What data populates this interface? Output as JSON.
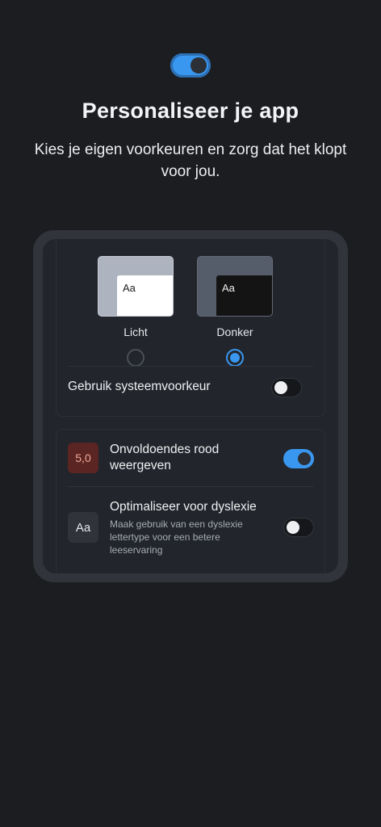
{
  "header": {
    "title": "Personaliseer je app",
    "subtitle": "Kies je eigen voorkeuren en zorg dat het klopt voor jou."
  },
  "theme": {
    "light": {
      "sample": "Aa",
      "label": "Licht",
      "selected": false
    },
    "dark": {
      "sample": "Aa",
      "label": "Donker",
      "selected": true
    },
    "system_pref": {
      "label": "Gebruik systeemvoorkeur",
      "enabled": false
    }
  },
  "options": {
    "red_grades": {
      "badge": "5,0",
      "title": "Onvoldoendes rood weergeven",
      "enabled": true
    },
    "dyslexia": {
      "badge": "Aa",
      "title": "Optimaliseer voor dyslexie",
      "description": "Maak gebruik van een dyslexie lettertype voor een betere leeservaring",
      "enabled": false
    }
  },
  "colors": {
    "accent": "#3a97f0",
    "background": "#1b1d21",
    "panel": "#22252b",
    "grade_badge": "#5a2522"
  }
}
